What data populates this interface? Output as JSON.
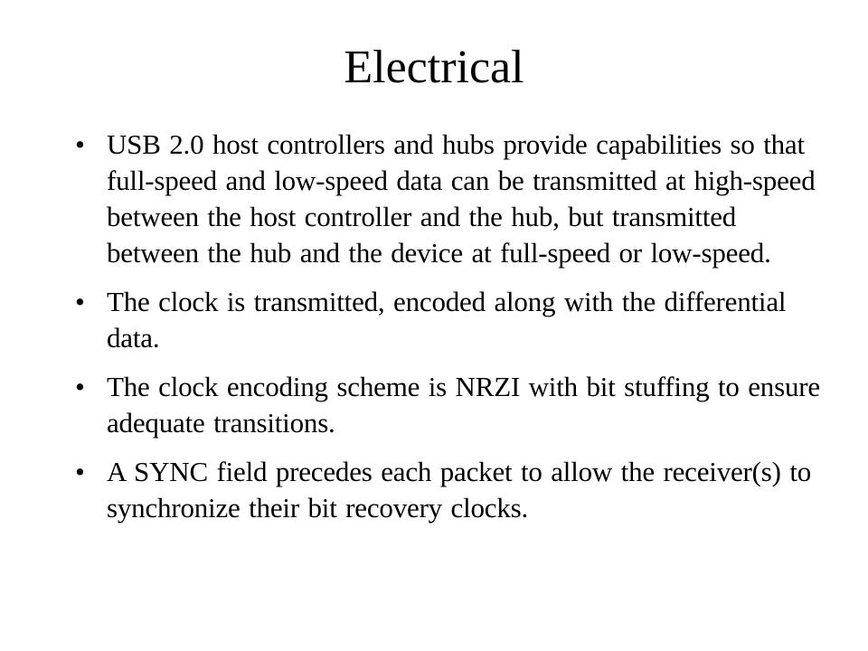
{
  "slide": {
    "title": "Electrical",
    "bullet_glyph": "•",
    "bullets": [
      "USB 2.0 host controllers and hubs provide capabilities so that full-speed and low-speed data can be transmitted at high-speed between the host controller and the hub, but transmitted between the hub and the device at full-speed or low-speed.",
      "The clock is transmitted, encoded along with the differential data.",
      "The clock encoding scheme is NRZI with bit stuffing to ensure adequate transitions.",
      "A SYNC field precedes each packet to allow the receiver(s) to synchronize their bit recovery clocks."
    ]
  }
}
